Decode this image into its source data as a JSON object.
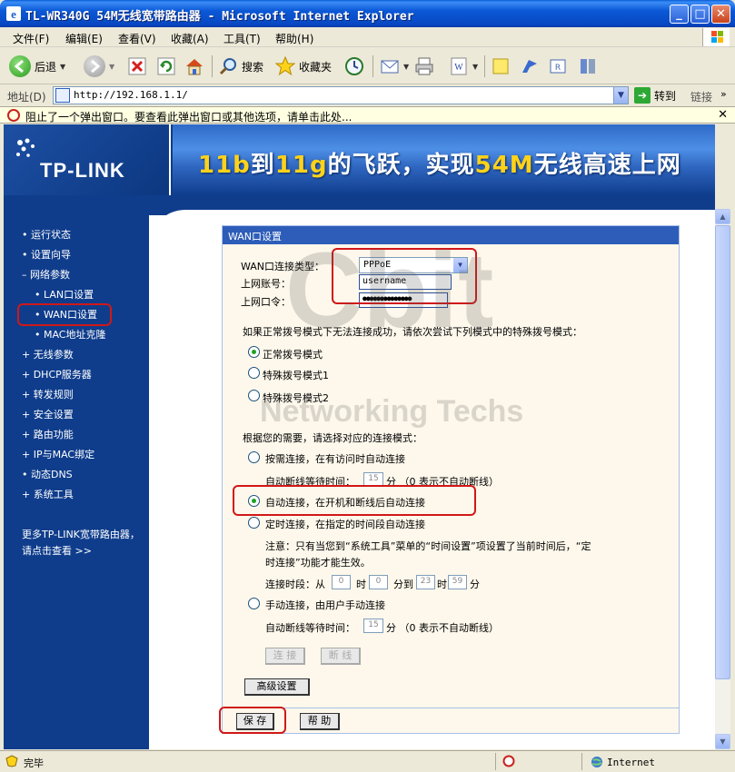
{
  "window": {
    "title": "TL-WR340G 54M无线宽带路由器 - Microsoft Internet Explorer"
  },
  "menu": [
    "文件(F)",
    "编辑(E)",
    "查看(V)",
    "收藏(A)",
    "工具(T)",
    "帮助(H)"
  ],
  "toolbar": {
    "back": "后退",
    "search": "搜索",
    "favorites": "收藏夹"
  },
  "address": {
    "label": "地址(D)",
    "url": "http://192.168.1.1/",
    "go": "转到",
    "links": "链接"
  },
  "popup_bar": {
    "text": "阻止了一个弹出窗口。要查看此弹出窗口或其他选项，请单击此处..."
  },
  "banner": {
    "logo": "TP-LINK",
    "slogan_1": "11b",
    "slogan_2": "到",
    "slogan_3": "11g",
    "slogan_4": "的飞跃，实现",
    "slogan_5": "54M",
    "slogan_6": "无线高速上网"
  },
  "sidebar": {
    "items": [
      "• 运行状态",
      "• 设置向导",
      "– 网络参数",
      "• LAN口设置",
      "• WAN口设置",
      "• MAC地址克隆",
      "+ 无线参数",
      "+ DHCP服务器",
      "+ 转发规则",
      "+ 安全设置",
      "+ 路由功能",
      "+ IP与MAC绑定",
      "• 动态DNS",
      "+ 系统工具"
    ],
    "more": "更多TP-LINK宽带路由器，请点击查看 >>"
  },
  "form": {
    "header": "WAN口设置",
    "conn_type_label": "WAN口连接类型：",
    "conn_type_value": "PPPoE",
    "account_label": "上网账号：",
    "account_value": "username",
    "password_label": "上网口令：",
    "password_value": "●●●●●●●●●●●●●●",
    "special_hint": "如果正常拨号模式下无法连接成功，请依次尝试下列模式中的特殊拨号模式：",
    "dial_modes": [
      "正常拨号模式",
      "特殊拨号模式1",
      "特殊拨号模式2"
    ],
    "conn_mode_hint": "根据您的需要，请选择对应的连接模式：",
    "on_demand": "按需连接，在有访问时自动连接",
    "idle_label_1": "自动断线等待时间：",
    "idle_value_1": "15",
    "idle_unit_1": "分 （0 表示不自动断线）",
    "auto_connect": "自动连接，在开机和断线后自动连接",
    "timed_connect": "定时连接，在指定的时间段自动连接",
    "note_1": "注意：只有当您到“系统工具”菜单的“时间设置”项设置了当前时间后，“定",
    "note_2": "时连接”功能才能生效。",
    "period_label": "连接时段：从",
    "period_h1": "0",
    "period_t1": "时",
    "period_m1": "0",
    "period_t2": "分到",
    "period_h2": "23",
    "period_t3": "时",
    "period_m2": "59",
    "period_t4": "分",
    "manual": "手动连接，由用户手动连接",
    "idle_label_2": "自动断线等待时间：",
    "idle_value_2": "15",
    "idle_unit_2": "分 （0 表示不自动断线）",
    "connect_btn": "连 接",
    "disconnect_btn": "断 线",
    "advanced_btn": "高级设置",
    "save_btn": "保 存",
    "help_btn": "帮 助"
  },
  "watermark": {
    "big": "Cbit",
    "small": "Networking Techs"
  },
  "status": {
    "text": "完毕",
    "zone": "Internet"
  }
}
